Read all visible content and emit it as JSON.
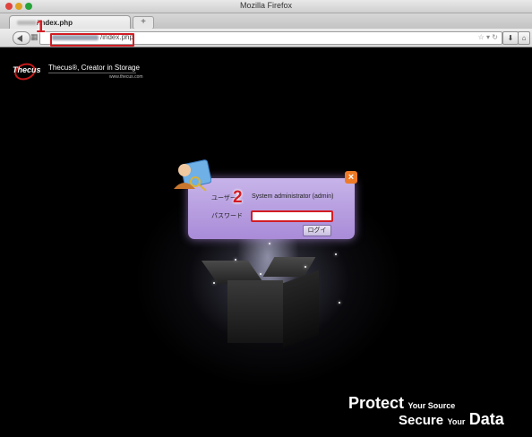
{
  "window": {
    "title": "Mozilla Firefox",
    "traffic_light_colors": [
      "#e0443e",
      "#dea123",
      "#27a33a"
    ]
  },
  "tab": {
    "label": "/index.php",
    "new_tab_symbol": "+"
  },
  "address_bar": {
    "value": "/index.php"
  },
  "page": {
    "logo_word": "Thecus",
    "logo_tagline": "Thecus®, Creator in Storage",
    "logo_url": "www.thecus.com",
    "login_dialog": {
      "user_label": "ユーザー",
      "user_value": "System administrator (admin)",
      "password_label": "パスワード",
      "password_value": "",
      "login_button": "ログイ",
      "close_symbol": "×"
    },
    "tagline": {
      "protect": "Protect",
      "your_source": "Your Source",
      "secure": "Secure",
      "your": "Your",
      "data": "Data"
    }
  },
  "annotations": {
    "marker_1": "1",
    "marker_2": "2",
    "highlight_color": "#d21d24"
  },
  "dialog_colors": {
    "top": "#c7b4e9",
    "bottom": "#a98bd8",
    "close": "#ee7a26"
  }
}
